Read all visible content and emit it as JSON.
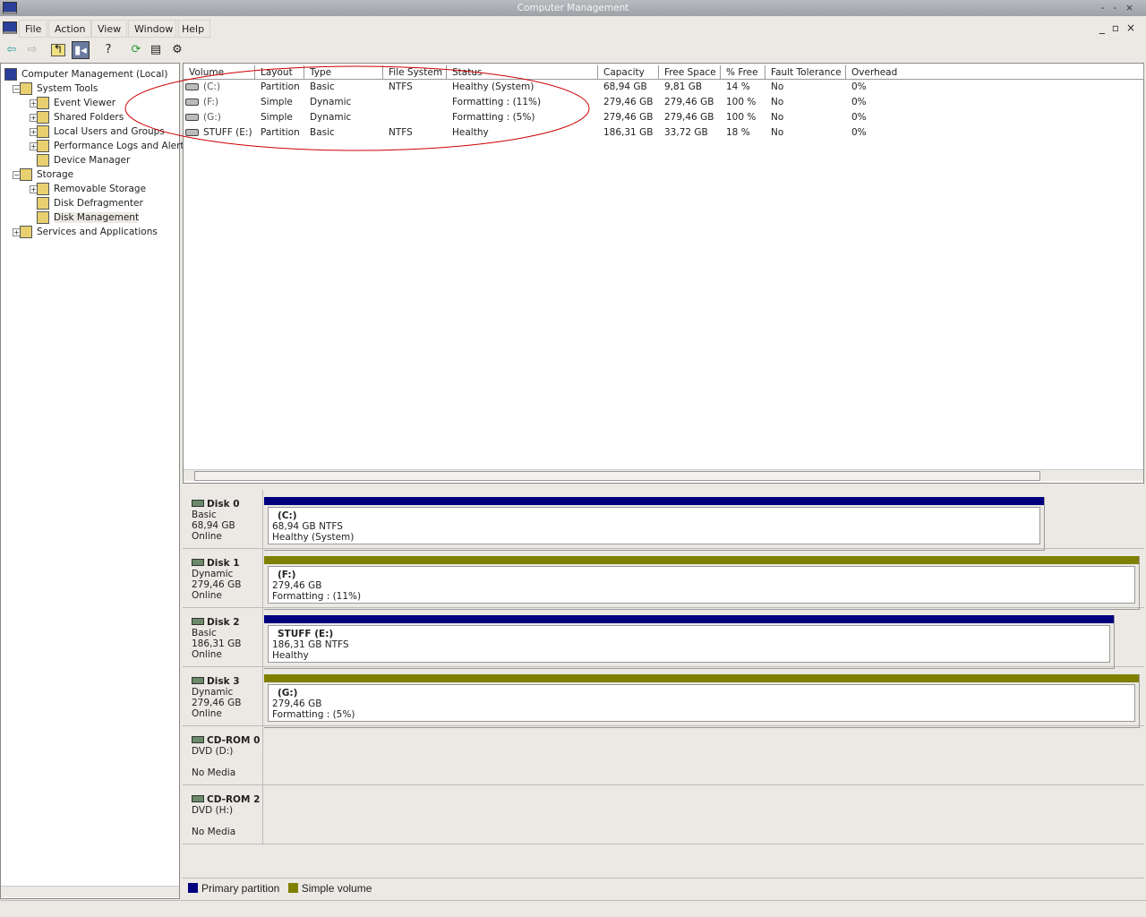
{
  "window": {
    "title": "Computer Management"
  },
  "menu": [
    "File",
    "Action",
    "View",
    "Window",
    "Help"
  ],
  "tree": [
    {
      "label": "Computer Management (Local)",
      "level": 0,
      "exp": ""
    },
    {
      "label": "System Tools",
      "level": 1,
      "exp": "−"
    },
    {
      "label": "Event Viewer",
      "level": 2,
      "exp": "+"
    },
    {
      "label": "Shared Folders",
      "level": 2,
      "exp": "+"
    },
    {
      "label": "Local Users and Groups",
      "level": 2,
      "exp": "+"
    },
    {
      "label": "Performance Logs and Alerts",
      "level": 2,
      "exp": "+"
    },
    {
      "label": "Device Manager",
      "level": 2,
      "exp": ""
    },
    {
      "label": "Storage",
      "level": 1,
      "exp": "−"
    },
    {
      "label": "Removable Storage",
      "level": 2,
      "exp": "+"
    },
    {
      "label": "Disk Defragmenter",
      "level": 2,
      "exp": ""
    },
    {
      "label": "Disk Management",
      "level": 2,
      "exp": "",
      "selected": true
    },
    {
      "label": "Services and Applications",
      "level": 1,
      "exp": "+"
    }
  ],
  "columns": [
    "Volume",
    "Layout",
    "Type",
    "File System",
    "Status",
    "Capacity",
    "Free Space",
    "% Free",
    "Fault Tolerance",
    "Overhead"
  ],
  "volumes": [
    [
      "(C:)",
      "Partition",
      "Basic",
      "NTFS",
      "Healthy (System)",
      "68,94 GB",
      "9,81 GB",
      "14 %",
      "No",
      "0%"
    ],
    [
      "(F:)",
      "Simple",
      "Dynamic",
      "",
      "Formatting : (11%)",
      "279,46 GB",
      "279,46 GB",
      "100 %",
      "No",
      "0%"
    ],
    [
      "(G:)",
      "Simple",
      "Dynamic",
      "",
      "Formatting : (5%)",
      "279,46 GB",
      "279,46 GB",
      "100 %",
      "No",
      "0%"
    ],
    [
      "STUFF (E:)",
      "Partition",
      "Basic",
      "NTFS",
      "Healthy",
      "186,31 GB",
      "33,72 GB",
      "18 %",
      "No",
      "0%"
    ]
  ],
  "disks": [
    {
      "name": "Disk 0",
      "type": "Basic",
      "size": "68,94 GB",
      "state": "Online",
      "part": {
        "label": "(C:)",
        "size": "68,94 GB NTFS",
        "status": "Healthy (System)",
        "kind": "primary"
      }
    },
    {
      "name": "Disk 1",
      "type": "Dynamic",
      "size": "279,46 GB",
      "state": "Online",
      "part": {
        "label": "(F:)",
        "size": "279,46 GB",
        "status": "Formatting : (11%)",
        "kind": "simple"
      }
    },
    {
      "name": "Disk 2",
      "type": "Basic",
      "size": "186,31 GB",
      "state": "Online",
      "part": {
        "label": "STUFF  (E:)",
        "size": "186,31 GB NTFS",
        "status": "Healthy",
        "kind": "primary"
      }
    },
    {
      "name": "Disk 3",
      "type": "Dynamic",
      "size": "279,46 GB",
      "state": "Online",
      "part": {
        "label": "(G:)",
        "size": "279,46 GB",
        "status": "Formatting : (5%)",
        "kind": "simple"
      }
    },
    {
      "name": "CD-ROM 0",
      "type": "DVD (D:)",
      "size": "",
      "state": "No Media"
    },
    {
      "name": "CD-ROM 2",
      "type": "DVD (H:)",
      "size": "",
      "state": "No Media"
    }
  ],
  "legend": [
    {
      "label": "Primary partition",
      "color": "#00007f"
    },
    {
      "label": "Simple volume",
      "color": "#7f7f00"
    }
  ],
  "colors": {
    "primary": "#00007f",
    "simple": "#7f7f00",
    "annotation": "#cc0000"
  }
}
